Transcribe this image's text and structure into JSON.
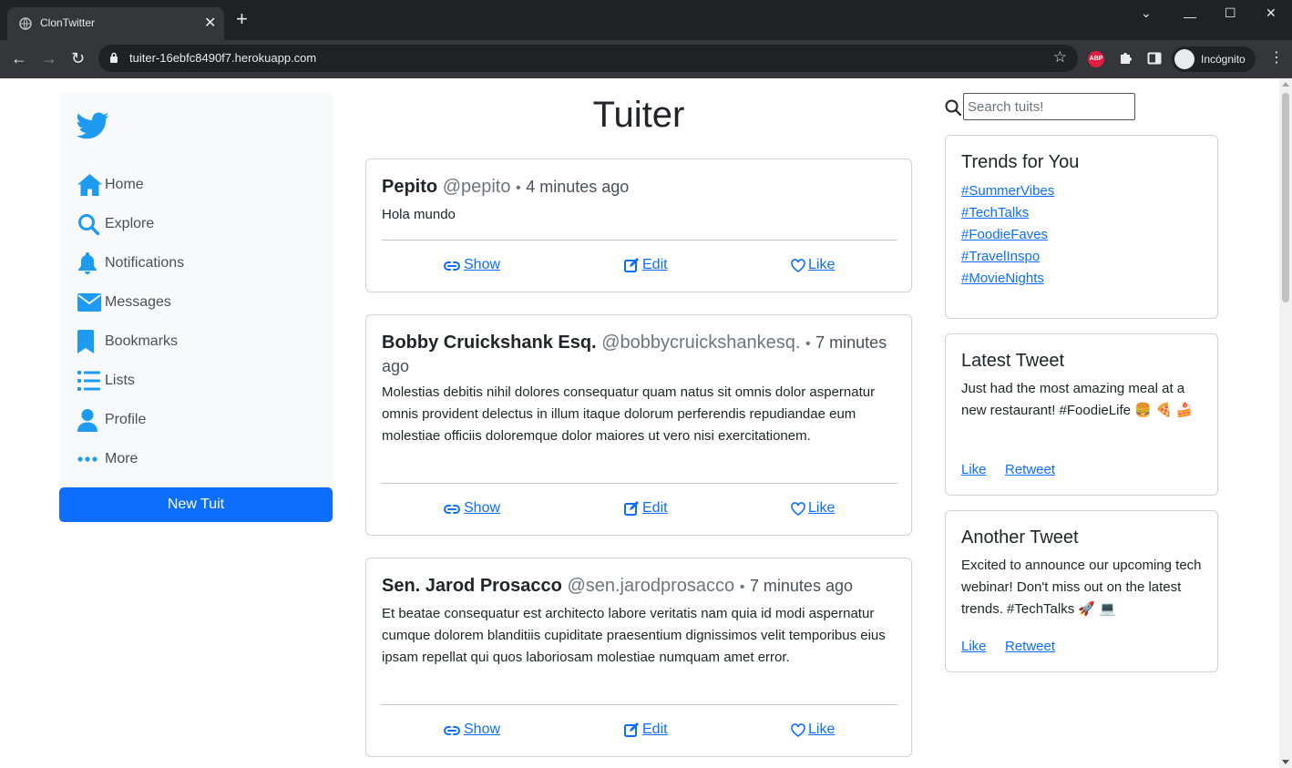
{
  "browser": {
    "tab_title": "ClonTwitter",
    "url": "tuiter-16ebfc8490f7.herokuapp.com",
    "profile_label": "Incógnito",
    "extension_badge": "ABP"
  },
  "sidebar": {
    "items": [
      {
        "label": "Home",
        "icon": "home-icon"
      },
      {
        "label": "Explore",
        "icon": "search-icon"
      },
      {
        "label": "Notifications",
        "icon": "bell-icon"
      },
      {
        "label": "Messages",
        "icon": "envelope-icon"
      },
      {
        "label": "Bookmarks",
        "icon": "bookmark-icon"
      },
      {
        "label": "Lists",
        "icon": "list-icon"
      },
      {
        "label": "Profile",
        "icon": "person-icon"
      },
      {
        "label": "More",
        "icon": "more-icon"
      }
    ],
    "new_tuit_label": "New Tuit"
  },
  "feed": {
    "title": "Tuiter",
    "tuits": [
      {
        "author": "Pepito",
        "handle": "@pepito",
        "time": "4 minutes ago",
        "content": "Hola mundo"
      },
      {
        "author": "Bobby Cruickshank Esq.",
        "handle": "@bobbycruickshankesq.",
        "time": "7 minutes ago",
        "content": "Molestias debitis nihil dolores consequatur quam natus sit omnis dolor aspernatur omnis provident delectus in illum itaque dolorum perferendis repudiandae eum molestiae officiis doloremque dolor maiores ut vero nisi exercitationem."
      },
      {
        "author": "Sen. Jarod Prosacco",
        "handle": "@sen.jarodprosacco",
        "time": "7 minutes ago",
        "content": "Et beatae consequatur est architecto labore veritatis nam quia id modi aspernatur cumque dolorem blanditiis cupiditate praesentium dignissimos velit temporibus eius ipsam repellat qui quos laboriosam molestiae numquam amet error."
      }
    ],
    "separator": "•",
    "actions": {
      "show": "Show",
      "edit": "Edit",
      "like": "Like"
    }
  },
  "right": {
    "search_placeholder": "Search tuits!",
    "trends": {
      "title": "Trends for You",
      "items": [
        "#SummerVibes",
        "#TechTalks",
        "#FoodieFaves",
        "#TravelInspo",
        "#MovieNights"
      ]
    },
    "latest": {
      "title": "Latest Tweet",
      "text": "Just had the most amazing meal at a new restaurant! #FoodieLife 🍔 🍕 🍰",
      "like": "Like",
      "retweet": "Retweet"
    },
    "another": {
      "title": "Another Tweet",
      "text": "Excited to announce our upcoming tech webinar! Don't miss out on the latest trends. #TechTalks 🚀 💻",
      "like": "Like",
      "retweet": "Retweet"
    }
  },
  "colors": {
    "accent": "#0d6efd",
    "twitter_blue": "#1d9bf0"
  }
}
